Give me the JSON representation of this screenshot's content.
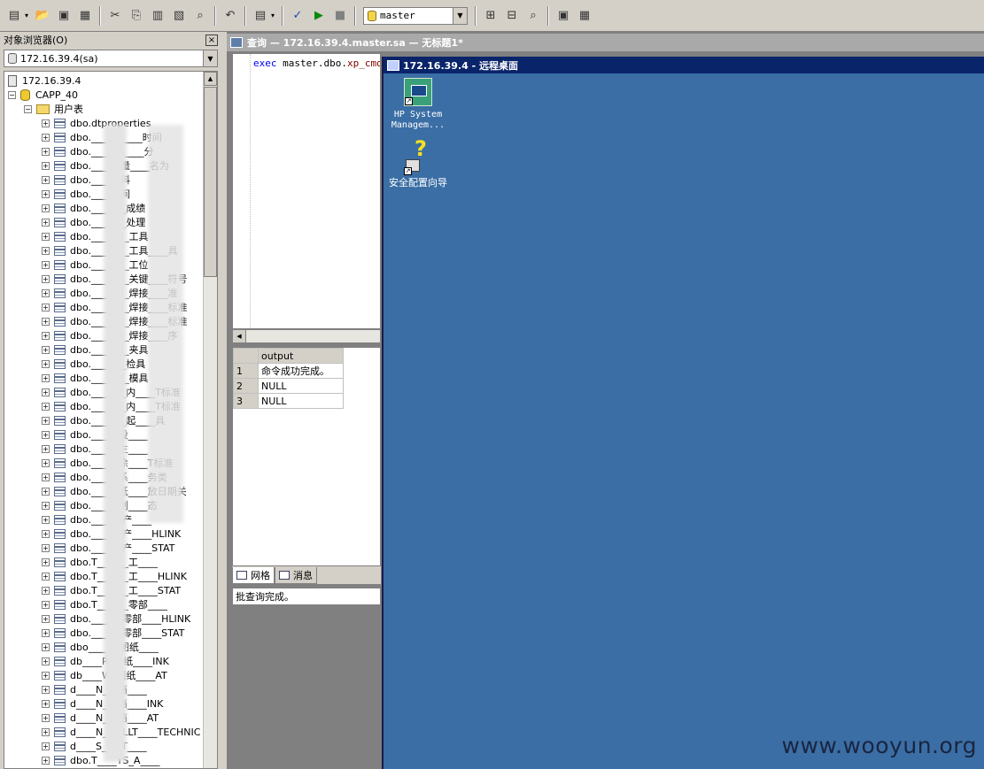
{
  "toolbar": {
    "database_select": "master",
    "icons": [
      "new-query-icon",
      "open-icon",
      "save-icon",
      "load-script-icon",
      "cut-icon",
      "copy-icon",
      "paste-icon",
      "clear-icon",
      "find-icon",
      "undo-icon",
      "results-mode-icon",
      "parse-icon",
      "execute-icon",
      "stop-icon",
      "object-browser-icon",
      "object-search-icon",
      "show-plan-icon",
      "options-icon",
      "results-pane-icon"
    ]
  },
  "object_browser": {
    "title": "对象浏览器(O)",
    "close_label": "×",
    "server_select": "172.16.39.4(sa)",
    "tree": {
      "server": "172.16.39.4",
      "database": "CAPP_40",
      "folder": "用户表",
      "tables": [
        "dbo.dtproperties",
        "dbo.____ST____时间",
        "dbo.____DS____分",
        "dbo.____变量____名为",
        "dbo.____材料",
        "dbo.____车间",
        "dbo.____DI_成绩",
        "dbo.____DI_处理",
        "dbo.____IDI_工具",
        "dbo.____IDI_工具____具",
        "dbo.____IDI_工位",
        "dbo.____IDI_关键____符号",
        "dbo.____IDI_焊接____准",
        "dbo.____IDI_焊接____标准",
        "dbo.____IDI_焊接____标准",
        "dbo.____IDI_焊接____序",
        "dbo.____IDI_夹具",
        "dbo.____DI_检具",
        "dbo.____IDI_模具",
        "dbo.____DI_内____T标准",
        "dbo.____DI_内____T标准",
        "dbo.____DI_起____具",
        "dbo.____I_设____",
        "dbo.____I_生____",
        "dbo.____I_涂____T标准",
        "dbo.____I_系____务类",
        "dbo.____I_纸____放日期关",
        "dbo.____I_制____态",
        "dbo.____R_产____",
        "dbo.____R_产____HLINK",
        "dbo.____R_产____STAT",
        "dbo.T____R_工____",
        "dbo.T____R_工____HLINK",
        "dbo.T____R_工____STAT",
        "dbo.T____R_零部____",
        "dbo.____R_零部____HLINK",
        "dbo.____R_零部____STAT",
        "dbo____R_图纸____",
        "db____R_图纸____INK",
        "db____W_图纸____AT",
        "d____N_文档____",
        "d____N_文档____INK",
        "d____N_文档____AT",
        "d____N____LLT____TECHNIC",
        "d____S____T____",
        "dbo.T____YS_A____"
      ]
    }
  },
  "query_window": {
    "title": "查询 — 172.16.39.4.master.sa — 无标题1*",
    "editor": {
      "keyword": "exec",
      "rest": " master.dbo.",
      "proc": "xp_cmdshell"
    },
    "results": {
      "columns": [
        "output"
      ],
      "rows": [
        {
          "n": "1",
          "value": "命令成功完成。"
        },
        {
          "n": "2",
          "value": "NULL"
        },
        {
          "n": "3",
          "value": "NULL"
        }
      ]
    },
    "tabs": [
      "网格",
      "消息"
    ],
    "status": "批查询完成。"
  },
  "remote_desktop": {
    "title": "172.16.39.4 - 远程桌面",
    "icons": [
      {
        "label_line1": "HP System",
        "label_line2": "Managem...",
        "icon": "hp-system-management-icon"
      },
      {
        "label_line1": "安全配置向导",
        "icon": "security-config-wizard-icon"
      }
    ]
  },
  "watermark": "www.wooyun.org"
}
